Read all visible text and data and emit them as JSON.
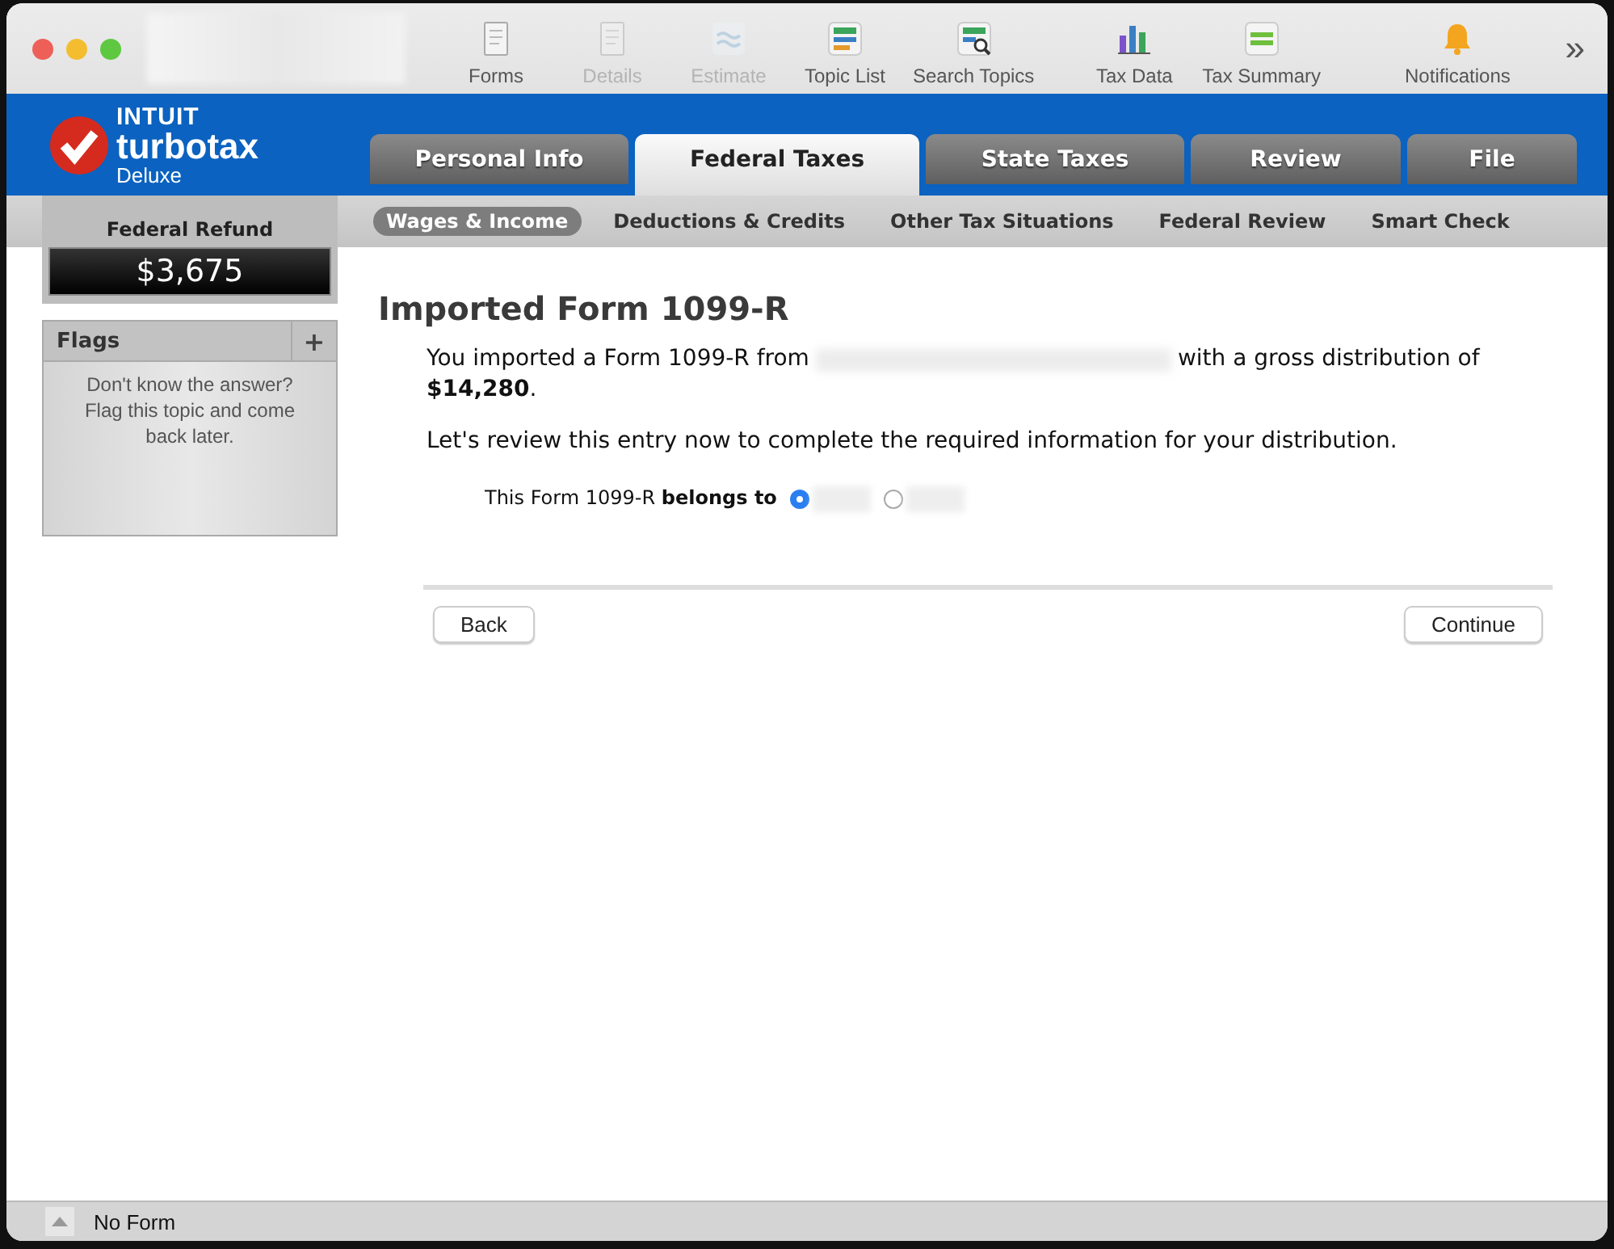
{
  "toolbar": [
    {
      "label": "Forms",
      "kind": "forms",
      "disabled": false
    },
    {
      "label": "Details",
      "kind": "details",
      "disabled": true
    },
    {
      "label": "Estimate",
      "kind": "estimate",
      "disabled": true
    },
    {
      "label": "Topic List",
      "kind": "topics",
      "disabled": false
    },
    {
      "label": "Search Topics",
      "kind": "search",
      "disabled": false
    },
    {
      "label": "Tax Data",
      "kind": "chart",
      "disabled": false
    },
    {
      "label": "Tax Summary",
      "kind": "summary",
      "disabled": false
    },
    {
      "label": "Notifications",
      "kind": "bell",
      "disabled": false
    }
  ],
  "overflow": "»",
  "logo": {
    "brand": "INTUIT",
    "product": "turbotax",
    "edition": "Deluxe"
  },
  "tabs": [
    {
      "label": "Personal Info",
      "selected": false
    },
    {
      "label": "Federal Taxes",
      "selected": true
    },
    {
      "label": "State Taxes",
      "selected": false
    },
    {
      "label": "Review",
      "selected": false
    },
    {
      "label": "File",
      "selected": false
    }
  ],
  "subtabs": [
    {
      "label": "Wages & Income",
      "selected": true
    },
    {
      "label": "Deductions & Credits",
      "selected": false
    },
    {
      "label": "Other Tax Situations",
      "selected": false
    },
    {
      "label": "Federal Review",
      "selected": false
    },
    {
      "label": "Smart Check",
      "selected": false
    }
  ],
  "refund": {
    "label": "Federal Refund",
    "amount": "$3,675"
  },
  "flags": {
    "title": "Flags",
    "add": "+",
    "hint": "Don't know the answer? Flag this topic and come back later."
  },
  "page": {
    "title": "Imported Form 1099-R",
    "intro_before": "You imported a Form 1099-R from",
    "intro_after": "with a gross distribution of",
    "intro_amount": "**$14,280**.",
    "review": "Let's review this entry now to complete the required information for your distribution.",
    "question": "This Form 1099-R **belongs to**",
    "options": [
      {
        "selected": true
      },
      {
        "selected": false
      }
    ]
  },
  "buttons": {
    "back": "Back",
    "continue": "Continue"
  },
  "status_bar": {
    "form": "No Form"
  }
}
